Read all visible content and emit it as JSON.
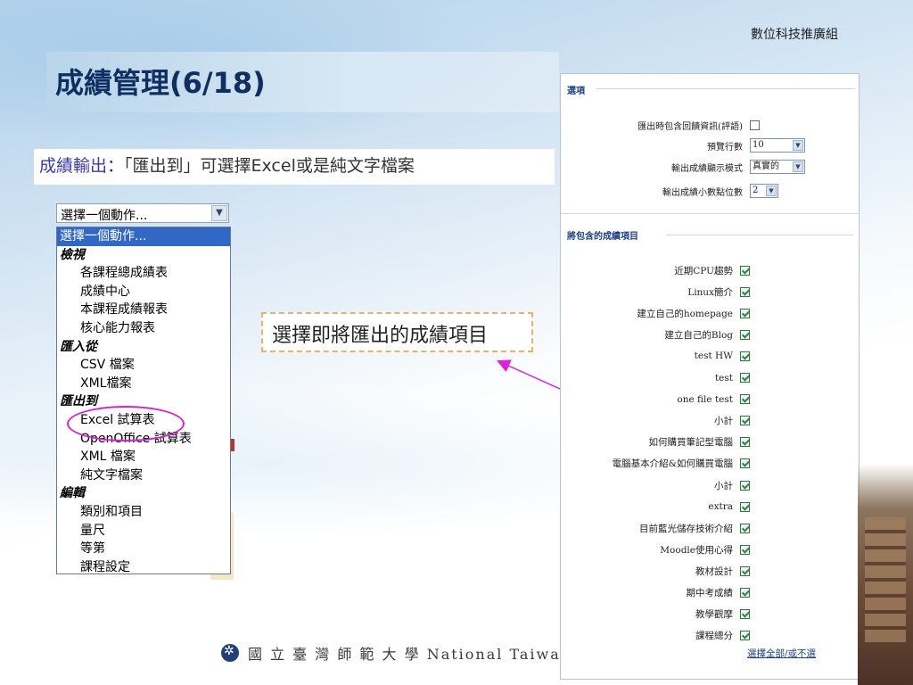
{
  "slide": {
    "title": "成績管理(6/18)",
    "org_label": "數位科技推廣組",
    "subtitle_accent": "成績輸出",
    "subtitle_rest": "：「匯出到」可選擇Excel或是純文字檔案",
    "callout": "選擇即將匯出的成績項目",
    "footer_text": "國 立 臺 灣 師 範 大 學  National Taiwa"
  },
  "dropdown": {
    "selected_value": "選擇一個動作...",
    "options": [
      {
        "label": "選擇一個動作...",
        "kind": "selected"
      },
      {
        "label": "檢視",
        "kind": "group"
      },
      {
        "label": "各課程總成績表",
        "kind": "item"
      },
      {
        "label": "成績中心",
        "kind": "item"
      },
      {
        "label": "本課程成績報表",
        "kind": "item"
      },
      {
        "label": "核心能力報表",
        "kind": "item"
      },
      {
        "label": "匯入從",
        "kind": "group"
      },
      {
        "label": "CSV 檔案",
        "kind": "item"
      },
      {
        "label": "XML檔案",
        "kind": "item"
      },
      {
        "label": "匯出到",
        "kind": "group"
      },
      {
        "label": "Excel 試算表",
        "kind": "item"
      },
      {
        "label": "OpenOffice 試算表",
        "kind": "item"
      },
      {
        "label": "XML 檔案",
        "kind": "item"
      },
      {
        "label": "純文字檔案",
        "kind": "item"
      },
      {
        "label": "編輯",
        "kind": "group"
      },
      {
        "label": "類別和項目",
        "kind": "item"
      },
      {
        "label": "量尺",
        "kind": "item"
      },
      {
        "label": "等第",
        "kind": "item"
      },
      {
        "label": "課程設定",
        "kind": "item"
      }
    ]
  },
  "panel": {
    "options_title": "選項",
    "options": {
      "include_feedback": {
        "label": "匯出時包含回饋資訊(評語)",
        "checked": false
      },
      "preview_rows": {
        "label": "預覽行數",
        "value": "10"
      },
      "display_mode": {
        "label": "輸出成績顯示模式",
        "value": "真實的"
      },
      "decimal_points": {
        "label": "輸出成績小數點位數",
        "value": "2"
      }
    },
    "grade_items_title": "將包含的成績項目",
    "grade_items": [
      {
        "label": "近期CPU趨勢",
        "checked": true
      },
      {
        "label": "Linux簡介",
        "checked": true
      },
      {
        "label": "建立自己的homepage",
        "checked": true
      },
      {
        "label": "建立自己的Blog",
        "checked": true
      },
      {
        "label": "test HW",
        "checked": true
      },
      {
        "label": "test",
        "checked": true
      },
      {
        "label": "one file test",
        "checked": true
      },
      {
        "label": "小計",
        "checked": true
      },
      {
        "label": "如何購買筆記型電腦",
        "checked": true
      },
      {
        "label": "電腦基本介紹&如何購買電腦",
        "checked": true
      },
      {
        "label": "小計",
        "checked": true
      },
      {
        "label": "extra",
        "checked": true
      },
      {
        "label": "目前藍光儲存技術介紹",
        "checked": true
      },
      {
        "label": "Moodle使用心得",
        "checked": true
      },
      {
        "label": "教材設計",
        "checked": true
      },
      {
        "label": "期中考成績",
        "checked": true
      },
      {
        "label": "教學觀摩",
        "checked": true
      },
      {
        "label": "課程總分",
        "checked": true
      }
    ],
    "select_all_link": "選擇全部/或不選"
  },
  "colors": {
    "title": "#0f2f63",
    "accent": "#3b3bb0",
    "highlight_circle": "#d81fd8",
    "arrow": "#e020e0",
    "callout_border": "#f0b060",
    "selected_row": "#3168c6"
  }
}
